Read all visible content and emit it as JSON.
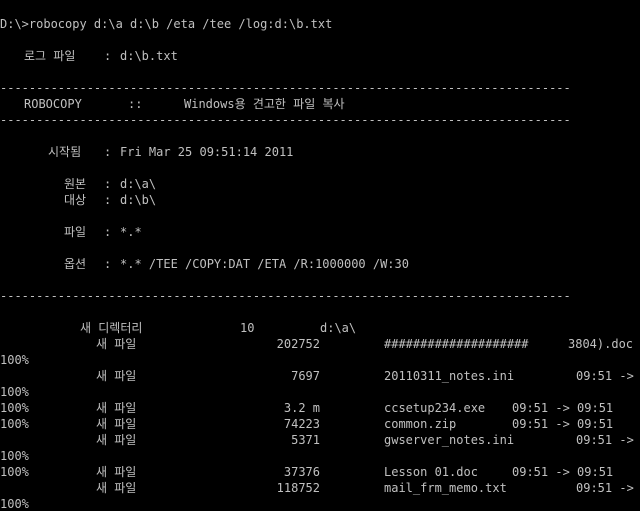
{
  "command_line": "D:\\>robocopy d:\\a d:\\b /eta /tee /log:d:\\b.txt",
  "log_file": {
    "label": "로그 파일",
    "sep": ":",
    "value": "d:\\b.txt"
  },
  "separator_line": "-------------------------------------------------------------------------------",
  "banner": {
    "name": "ROBOCOPY",
    "sep": "::",
    "title": "Windows용 견고한 파일 복사"
  },
  "started": {
    "label": "시작됨",
    "sep": ":",
    "value": "Fri Mar 25 09:51:14 2011"
  },
  "source": {
    "label": "원본",
    "sep": ":",
    "value": "d:\\a\\"
  },
  "dest": {
    "label": "대상",
    "sep": ":",
    "value": "d:\\b\\"
  },
  "files": {
    "label": "파일",
    "sep": ":",
    "value": "*.*"
  },
  "options": {
    "label": "옵션",
    "sep": ":",
    "value": "*.* /TEE /COPY:DAT /ETA /R:1000000 /W:30"
  },
  "new_dir": {
    "label": "새 디렉터리",
    "count": "10",
    "path": "d:\\a\\"
  },
  "rows": [
    {
      "label": "새 파일",
      "size": "202752",
      "name": "####################",
      "eta": "3804).doc"
    },
    {
      "label": "새 파일",
      "size": "7697",
      "name": "20110311_notes.ini",
      "eta": "09:51 ->"
    },
    {
      "label": "새 파일",
      "size": "3.2 m",
      "name": "ccsetup234.exe",
      "eta": "09:51 -> 09:51"
    },
    {
      "label": "새 파일",
      "size": "74223",
      "name": "common.zip",
      "eta": "09:51 -> 09:51"
    },
    {
      "label": "새 파일",
      "size": "5371",
      "name": "gwserver_notes.ini",
      "eta": "09:51 ->"
    },
    {
      "label": "새 파일",
      "size": "37376",
      "name": "Lesson 01.doc",
      "eta": "09:51 -> 09:51"
    },
    {
      "label": "새 파일",
      "size": "118752",
      "name": "mail_frm_memo.txt",
      "eta": "09:51 ->"
    }
  ],
  "percent": "100%"
}
